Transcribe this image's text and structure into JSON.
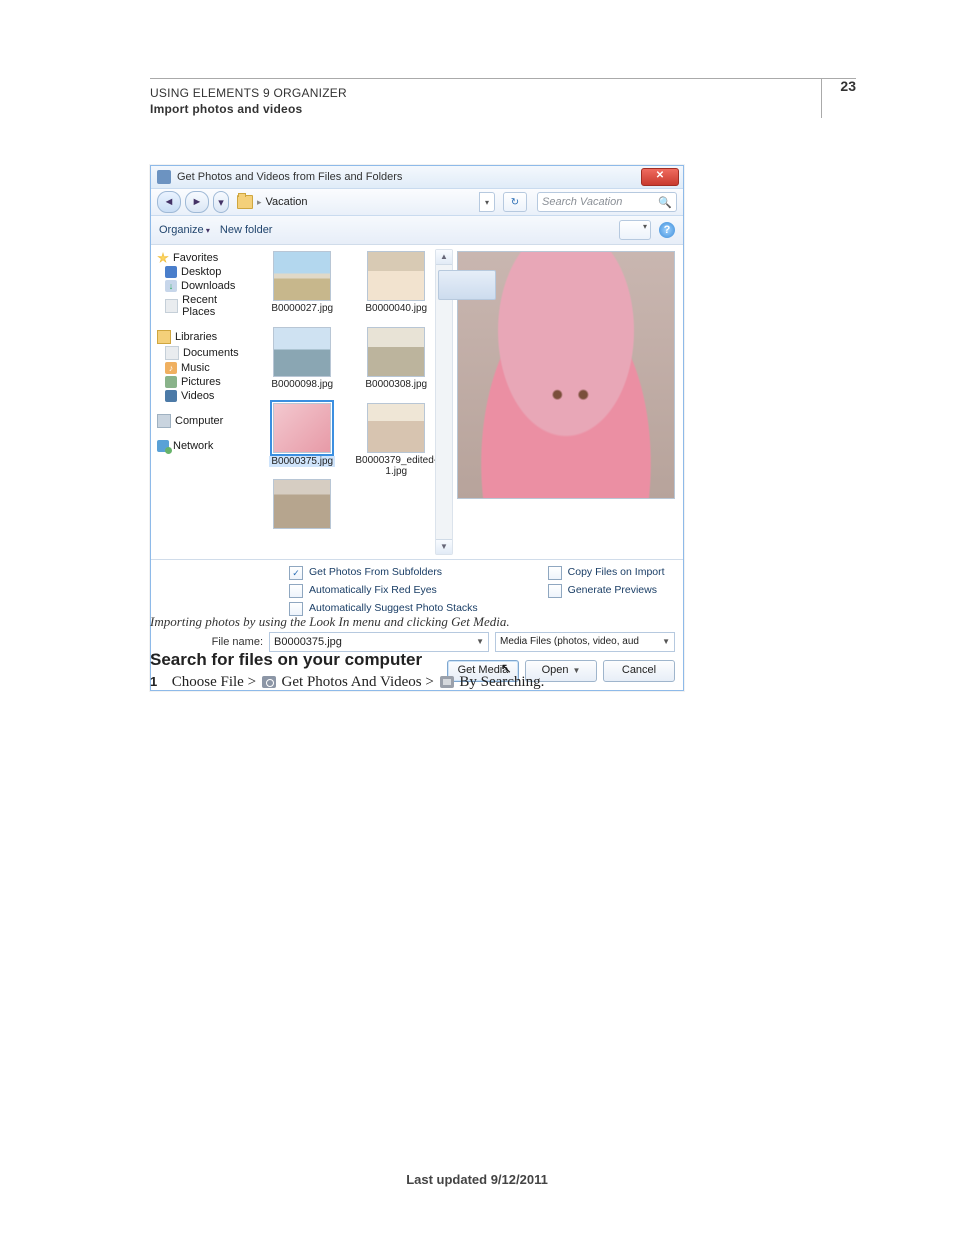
{
  "page_number": "23",
  "header": {
    "line1": "USING ELEMENTS 9 ORGANIZER",
    "line2": "Import photos and videos"
  },
  "footer": "Last updated 9/12/2011",
  "dialog": {
    "title": "Get Photos and Videos from Files and Folders",
    "close_label": "✕",
    "nav": {
      "back_glyph": "◄",
      "fwd_glyph": "►",
      "drop_glyph": "▾",
      "crumb_sep": "▸",
      "location": "Vacation",
      "refresh_glyph": "↻",
      "search_placeholder": "Search Vacation",
      "search_glyph": "🔍"
    },
    "toolbar": {
      "organize": "Organize",
      "newfolder": "New folder",
      "help": "?"
    },
    "side": {
      "favorites": "Favorites",
      "desktop": "Desktop",
      "downloads": "Downloads",
      "recent": "Recent Places",
      "libraries": "Libraries",
      "documents": "Documents",
      "music": "Music",
      "pictures": "Pictures",
      "videos": "Videos",
      "computer": "Computer",
      "network": "Network"
    },
    "files": {
      "f1": "B0000027.jpg",
      "f2": "B0000040.jpg",
      "f3": "B0000098.jpg",
      "f4": "B0000308.jpg",
      "f5": "B0000375.jpg",
      "f6": "B0000379_edited-1.jpg"
    },
    "options": {
      "subfolders": "Get Photos From Subfolders",
      "redeye": "Automatically Fix Red Eyes",
      "stacks": "Automatically Suggest Photo Stacks",
      "copy": "Copy Files on Import",
      "previews": "Generate Previews"
    },
    "bottom": {
      "filename_label": "File name:",
      "filename_value": "B0000375.jpg",
      "type_filter": "Media Files (photos, video, aud",
      "btn_getmedia": "Get Media",
      "btn_open": "Open",
      "btn_cancel": "Cancel"
    }
  },
  "caption": "Importing photos by using the Look In menu and clicking Get Media.",
  "section_heading": "Search for files on your computer",
  "step": {
    "num": "1",
    "t1": "Choose File > ",
    "t2": " Get Photos And Videos > ",
    "t3": " By Searching."
  }
}
